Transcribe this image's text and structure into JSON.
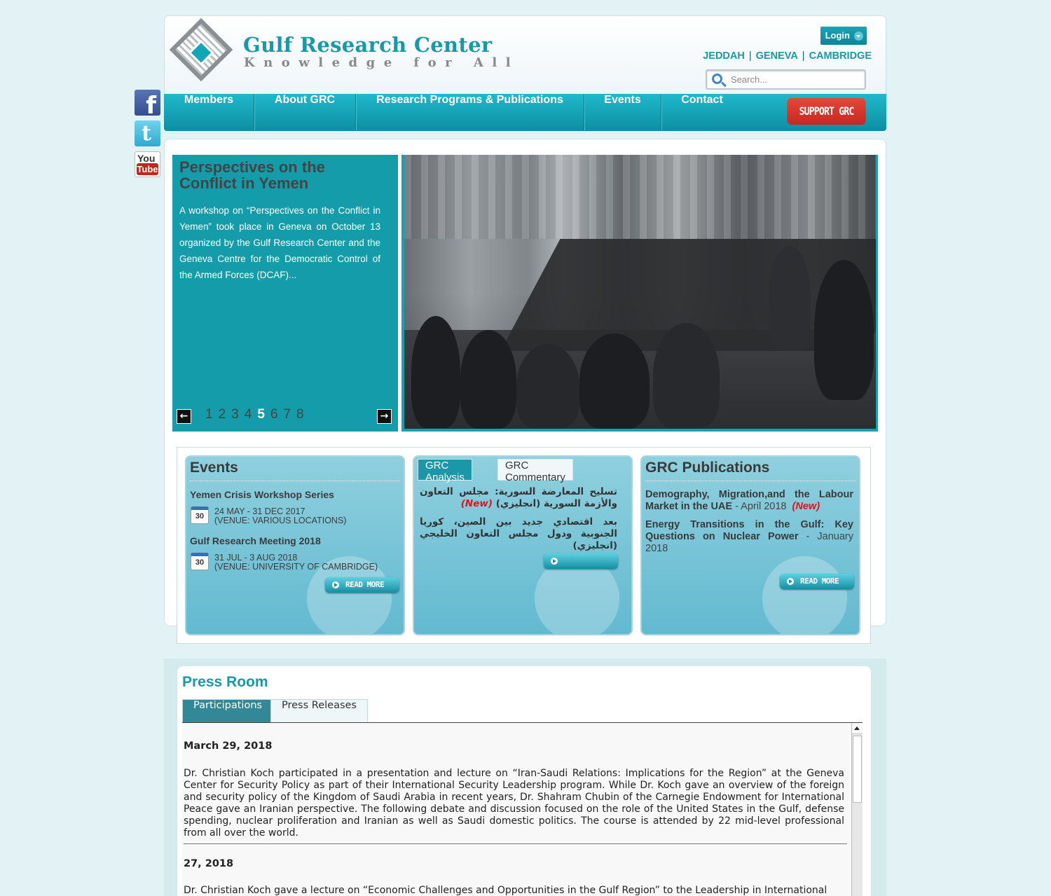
{
  "header": {
    "logo_title": "Gulf Research Center",
    "logo_tagline": "Knowledge for All",
    "login_label": "Login",
    "cities": [
      "JEDDAH",
      "GENEVA",
      "CAMBRIDGE"
    ],
    "search_placeholder": "Search..."
  },
  "social": [
    "facebook-icon",
    "twitter-icon",
    "youtube-icon"
  ],
  "social_youtube_text": [
    "You",
    "Tube"
  ],
  "nav": {
    "items": [
      "Members",
      "About GRC",
      "Research Programs & Publications",
      "Events",
      "Contact"
    ],
    "support_label": "SUPPORT GRC"
  },
  "slider": {
    "title": "Perspectives on the Conflict in Yemen",
    "text": "A workshop on “Perspectives on the Conflict in Yemen” took place in Geneva on October 13 organized by the Gulf Research Center and the Geneva Centre for the Democratic Control of the Armed Forces (DCAF)...",
    "pages": [
      "1",
      "2",
      "3",
      "4",
      "5",
      "6",
      "7",
      "8"
    ],
    "active_page": "5"
  },
  "events": {
    "title": "Events",
    "items": [
      {
        "title": "Yemen Crisis Workshop Series",
        "cal_day": "30",
        "date": "24 MAY - 31 DEC 2017",
        "venue": "(VENUE: VARIOUS LOCATIONS)"
      },
      {
        "title": "Gulf Research Meeting 2018",
        "cal_day": "30",
        "date": "31 JUL - 3 AUG 2018",
        "venue": "(VENUE: UNIVERSITY OF CAMBRIDGE)"
      }
    ],
    "read_more": "READ MORE"
  },
  "analysis": {
    "tabs": [
      "GRC Analysis",
      "GRC Commentary"
    ],
    "items": [
      {
        "text": "تسليح المعارضة السورية: مجلس التعاون والأزمة السورية (انجليزي)",
        "badge": "(New)"
      },
      {
        "text": "بعد اقتصادي جديد بين الصين، كوريا الجنوبية ودول مجلس التعاون الخليجي (انجليزي)",
        "badge": ""
      }
    ]
  },
  "publications": {
    "title": "GRC Publications",
    "items": [
      {
        "title": "Demography, Migration,and the Labour Market in the UAE",
        "date": " - April 2018",
        "badge": "(New)"
      },
      {
        "title": "Energy Transitions in the Gulf: Key Questions on Nuclear Power",
        "date": " - January 2018",
        "badge": ""
      }
    ],
    "read_more": "READ MORE"
  },
  "press": {
    "title": "Press Room",
    "tabs": [
      "Participations",
      "Press Releases"
    ],
    "entries": [
      {
        "date": "March 29, 2018",
        "text": "Dr. Christian Koch participated in a presentation and lecture on “Iran-Saudi Relations: Implications for the Region” at the Geneva Center for Security Policy as part of their International Security Leadership program. While Dr. Koch gave an overview of the foreign and security policy of the Kingdom of Saudi Arabia in recent years, Dr. Shahram Chubin of the Carnegie Endowment for International Peace gave an Iranian perspective. The following debate and discussion focused on the role of the United States in the Gulf, defense spending, nuclear proliferation and Iranian as well as Saudi domestic politics. The course is attended by 22 mid-level professional from all over the world."
      },
      {
        "date": "27, 2018",
        "text": "Dr. Christian Koch gave a lecture on “Economic Challenges and Opportunities in the Gulf Region” to the Leadership in International"
      }
    ]
  }
}
